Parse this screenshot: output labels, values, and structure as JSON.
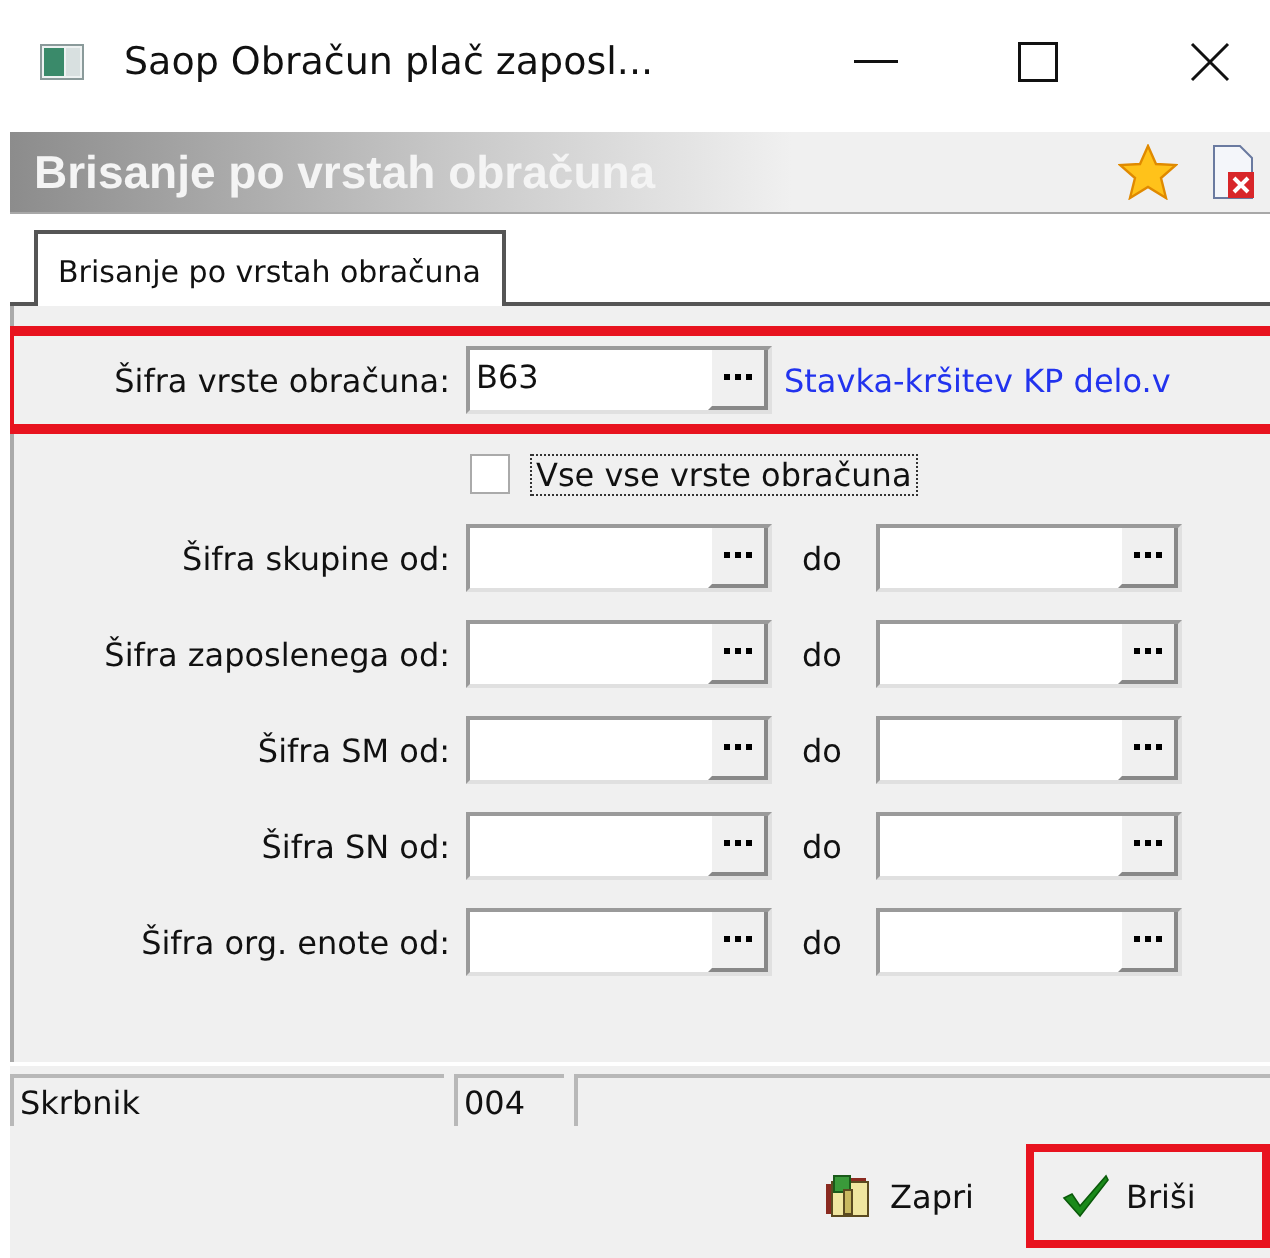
{
  "window": {
    "title": "Saop Obračun plač zaposl..."
  },
  "header": {
    "title": "Brisanje po vrstah obračuna"
  },
  "tabs": [
    {
      "label": "Brisanje po vrstah obračuna",
      "selected": true
    }
  ],
  "code_field": {
    "label": "Šifra vrste obračuna:",
    "value": "B63",
    "description": "Stavka-kršitev KP delo.v",
    "highlighted": true
  },
  "all_types": {
    "label": "Vse vse vrste obračuna",
    "checked": false
  },
  "ranges": [
    {
      "label": "Šifra skupine od:",
      "to_label": "do"
    },
    {
      "label": "Šifra zaposlenega od:",
      "to_label": "do"
    },
    {
      "label": "Šifra SM od:",
      "to_label": "do"
    },
    {
      "label": "Šifra SN od:",
      "to_label": "do"
    },
    {
      "label": "Šifra org. enote od:",
      "to_label": "do"
    }
  ],
  "status_bar": {
    "user": "Skrbnik",
    "code": "004"
  },
  "buttons": [
    {
      "label": "Zapri",
      "kind": "close",
      "highlighted": false
    },
    {
      "label": "Briši",
      "kind": "delete",
      "highlighted": true
    }
  ]
}
